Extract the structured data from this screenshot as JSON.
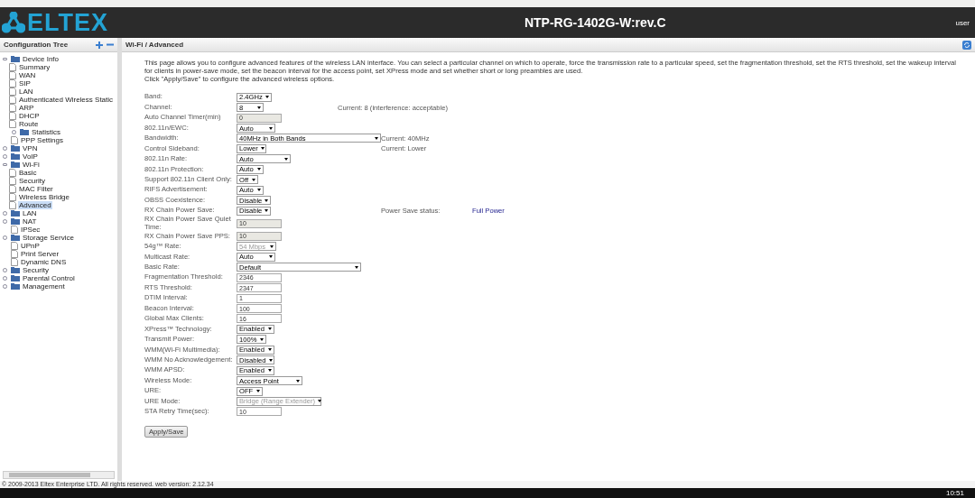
{
  "header": {
    "logo": "ELTEX",
    "title": "NTP-RG-1402G-W:rev.C",
    "user": "user"
  },
  "tree": {
    "title": "Configuration Tree",
    "nodes": [
      {
        "label": "Device Info",
        "kind": "folder",
        "expanded": true,
        "selected": false,
        "children": [
          {
            "label": "Summary",
            "kind": "page",
            "selected": false
          },
          {
            "label": "WAN",
            "kind": "page",
            "selected": false
          },
          {
            "label": "SIP",
            "kind": "page",
            "selected": false
          },
          {
            "label": "LAN",
            "kind": "page",
            "selected": false
          },
          {
            "label": "Authenticated Wireless Static",
            "kind": "page",
            "selected": false
          },
          {
            "label": "ARP",
            "kind": "page",
            "selected": false
          },
          {
            "label": "DHCP",
            "kind": "page",
            "selected": false
          },
          {
            "label": "Route",
            "kind": "page",
            "selected": false
          },
          {
            "label": "Statistics",
            "kind": "folder",
            "expanded": false,
            "selected": false
          }
        ]
      },
      {
        "label": "PPP Settings",
        "kind": "page",
        "selected": false
      },
      {
        "label": "VPN",
        "kind": "folder",
        "expanded": false,
        "selected": false
      },
      {
        "label": "VoIP",
        "kind": "folder",
        "expanded": false,
        "selected": false
      },
      {
        "label": "Wi-Fi",
        "kind": "folder",
        "expanded": true,
        "selected": false,
        "children": [
          {
            "label": "Basic",
            "kind": "page",
            "selected": false
          },
          {
            "label": "Security",
            "kind": "page",
            "selected": false
          },
          {
            "label": "MAC Filter",
            "kind": "page",
            "selected": false
          },
          {
            "label": "Wireless Bridge",
            "kind": "page",
            "selected": false
          },
          {
            "label": "Advanced",
            "kind": "page",
            "selected": true
          }
        ]
      },
      {
        "label": "LAN",
        "kind": "folder",
        "expanded": false,
        "selected": false
      },
      {
        "label": "NAT",
        "kind": "folder",
        "expanded": false,
        "selected": false
      },
      {
        "label": "IPSec",
        "kind": "page",
        "selected": false
      },
      {
        "label": "Storage Service",
        "kind": "folder",
        "expanded": false,
        "selected": false
      },
      {
        "label": "UPnP",
        "kind": "page",
        "selected": false
      },
      {
        "label": "Print Server",
        "kind": "page",
        "selected": false
      },
      {
        "label": "Dynamic DNS",
        "kind": "page",
        "selected": false
      },
      {
        "label": "Security",
        "kind": "folder",
        "expanded": false,
        "selected": false
      },
      {
        "label": "Parental Control",
        "kind": "folder",
        "expanded": false,
        "selected": false
      },
      {
        "label": "Management",
        "kind": "folder",
        "expanded": false,
        "selected": false
      }
    ]
  },
  "page": {
    "title": "Wi-Fi / Advanced",
    "description": [
      "This page allows you to configure advanced features of the wireless LAN interface. You can select a particular channel on which to operate, force the transmission rate to a particular speed, set the fragmentation threshold, set the RTS threshold, set the wakeup interval for clients in power-save mode, set the beacon interval for the access point, set XPress mode and set whether short or long preambles are used.",
      "Click \"Apply/Save\" to configure the advanced wireless options."
    ],
    "fields": [
      {
        "label": "Band:",
        "kind": "select",
        "value": "2.4GHz",
        "disabled": false
      },
      {
        "label": "Channel:",
        "kind": "select",
        "value": "8",
        "disabled": false,
        "notes": [
          {
            "kind": "text",
            "text": "Current: 8 (interference: acceptable)"
          }
        ]
      },
      {
        "label": "Auto Channel Timer(min)",
        "kind": "input",
        "value": "0",
        "disabled": true
      },
      {
        "label": "802.11n/EWC:",
        "kind": "select",
        "value": "Auto",
        "disabled": false
      },
      {
        "label": "Bandwidth:",
        "kind": "select",
        "value": "40MHz in Both Bands",
        "disabled": false,
        "notes": [
          {
            "kind": "text",
            "text": "Current: 40MHz"
          }
        ]
      },
      {
        "label": "Control Sideband:",
        "kind": "select",
        "value": "Lower",
        "disabled": false,
        "notes": [
          {
            "kind": "text",
            "text": "Current: Lower"
          }
        ]
      },
      {
        "label": "802.11n Rate:",
        "kind": "select",
        "value": "Auto",
        "disabled": false
      },
      {
        "label": "802.11n Protection:",
        "kind": "select",
        "value": "Auto",
        "disabled": false
      },
      {
        "label": "Support 802.11n Client Only:",
        "kind": "select",
        "value": "Off",
        "disabled": false
      },
      {
        "label": "RIFS Advertisement:",
        "kind": "select",
        "value": "Auto",
        "disabled": false
      },
      {
        "label": "OBSS Coexistence:",
        "kind": "select",
        "value": "Disable",
        "disabled": false
      },
      {
        "label": "RX Chain Power Save:",
        "kind": "select",
        "value": "Disable",
        "disabled": false,
        "notes": [
          {
            "kind": "text",
            "text": "Power Save status:"
          },
          {
            "kind": "status",
            "text": "Full Power"
          }
        ]
      },
      {
        "label": "RX Chain Power Save Quiet Time:",
        "kind": "input",
        "value": "10",
        "disabled": true
      },
      {
        "label": "RX Chain Power Save PPS:",
        "kind": "input",
        "value": "10",
        "disabled": true
      },
      {
        "label": "54g™ Rate:",
        "kind": "select",
        "value": "54 Mbps",
        "disabled": true
      },
      {
        "label": "Multicast Rate:",
        "kind": "select",
        "value": "Auto",
        "disabled": false
      },
      {
        "label": "Basic Rate:",
        "kind": "select",
        "value": "Default",
        "disabled": false
      },
      {
        "label": "Fragmentation Threshold:",
        "kind": "input",
        "value": "2346",
        "disabled": false
      },
      {
        "label": "RTS Threshold:",
        "kind": "input",
        "value": "2347",
        "disabled": false
      },
      {
        "label": "DTIM Interval:",
        "kind": "input",
        "value": "1",
        "disabled": false
      },
      {
        "label": "Beacon Interval:",
        "kind": "input",
        "value": "100",
        "disabled": false
      },
      {
        "label": "Global Max Clients:",
        "kind": "input",
        "value": "16",
        "disabled": false
      },
      {
        "label": "XPress™ Technology:",
        "kind": "select",
        "value": "Enabled",
        "disabled": false
      },
      {
        "label": "Transmit Power:",
        "kind": "select",
        "value": "100%",
        "disabled": false
      },
      {
        "label": "WMM(Wi-Fi Multimedia):",
        "kind": "select",
        "value": "Enabled",
        "disabled": false
      },
      {
        "label": "WMM No Acknowledgement:",
        "kind": "select",
        "value": "Disabled",
        "disabled": false
      },
      {
        "label": "WMM APSD:",
        "kind": "select",
        "value": "Enabled",
        "disabled": false
      },
      {
        "label": "Wireless Mode:",
        "kind": "select",
        "value": "Access Point",
        "disabled": false
      },
      {
        "label": "URE:",
        "kind": "select",
        "value": "OFF",
        "disabled": false
      },
      {
        "label": "URE Mode:",
        "kind": "select",
        "value": "Bridge (Range Extender)",
        "disabled": true
      },
      {
        "label": "STA Retry Time(sec):",
        "kind": "input",
        "value": "10",
        "disabled": false
      }
    ],
    "button": "Apply/Save"
  },
  "footer": "© 2009-2013 Eltex Enterprise LTD. All rights reserved. web version: 2.12.34",
  "taskbar": {
    "clock": "10:51"
  }
}
